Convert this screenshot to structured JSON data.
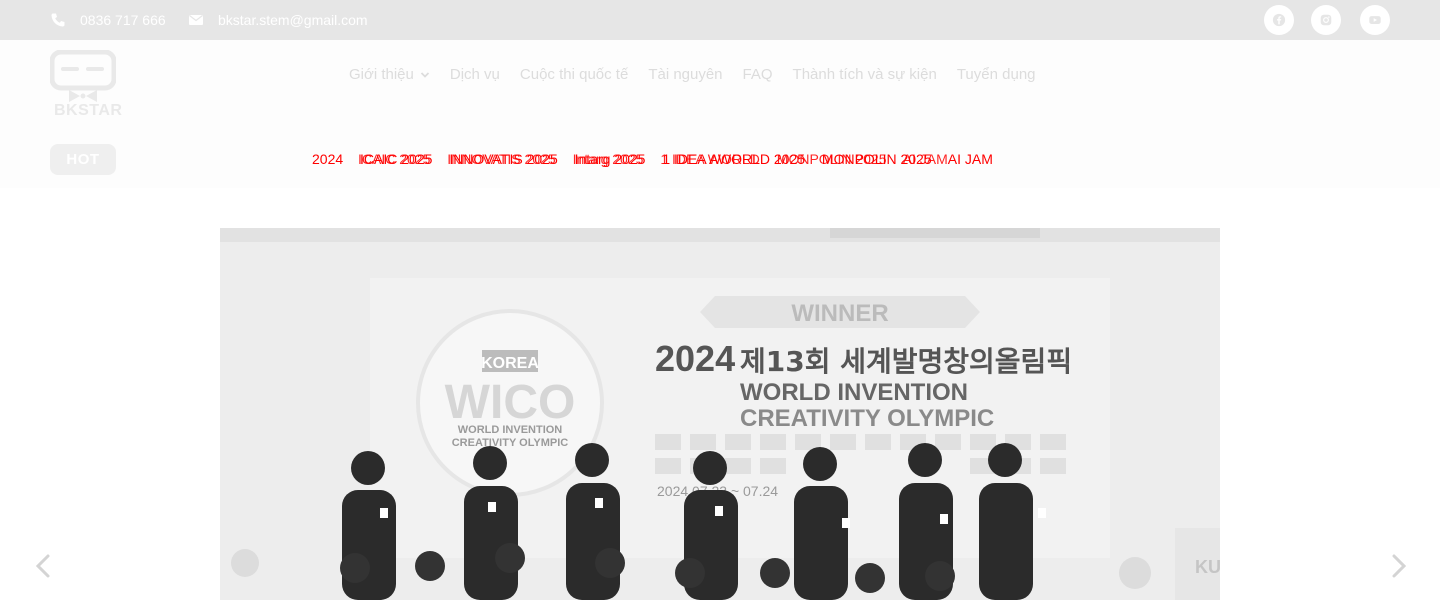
{
  "topbar": {
    "phone": "0836 717 666",
    "email": "bkstar.stem@gmail.com",
    "social": [
      {
        "icon": "facebook-icon"
      },
      {
        "icon": "instagram-icon"
      },
      {
        "icon": "youtube-icon"
      }
    ]
  },
  "brand": {
    "logo_text": "BKSTAR"
  },
  "nav": {
    "items": [
      {
        "label": "Giới thiệu",
        "has_dropdown": true
      },
      {
        "label": "Dịch vụ"
      },
      {
        "label": "Cuộc thi quốc tế"
      },
      {
        "label": "Tài nguyên"
      },
      {
        "label": "FAQ"
      },
      {
        "label": "Thành tích và sự kiện"
      },
      {
        "label": "Tuyển dụng"
      }
    ]
  },
  "ticker": {
    "badge": "HOT",
    "items_a": [
      "2024",
      "ICAIC 2025",
      "INNOVATIS 2025",
      "Intarg 2025",
      "1 IDEA AWORLD 2025",
      "MONPOLIN 2025",
      "AI JAM"
    ],
    "items_b": [
      "ICAIC 2025",
      "INNOVATIS 2025",
      "Intarg 2025",
      "1 IDEA WORLD",
      "MONPOLIN 2025",
      "AI JAM"
    ]
  },
  "slider": {
    "banner_top": "WINNER",
    "banner_year": "2024",
    "banner_korean": "제13회 세계발명창의올림픽",
    "banner_en_1": "WORLD INVENTION",
    "banner_en_2": "CREATIVITY OLYMPIC",
    "logo_country": "KOREA",
    "logo_main": "WICO",
    "logo_sub_1": "WORLD INVENTION",
    "logo_sub_2": "CREATIVITY OLYMPIC",
    "date_text": "2024.07.23 ~ 07.24",
    "right_badge": "KU"
  },
  "colors": {
    "topbar_bg": "#e6e6e6",
    "ticker_text": "#ff0000",
    "nav_text": "#dcdcdc"
  }
}
